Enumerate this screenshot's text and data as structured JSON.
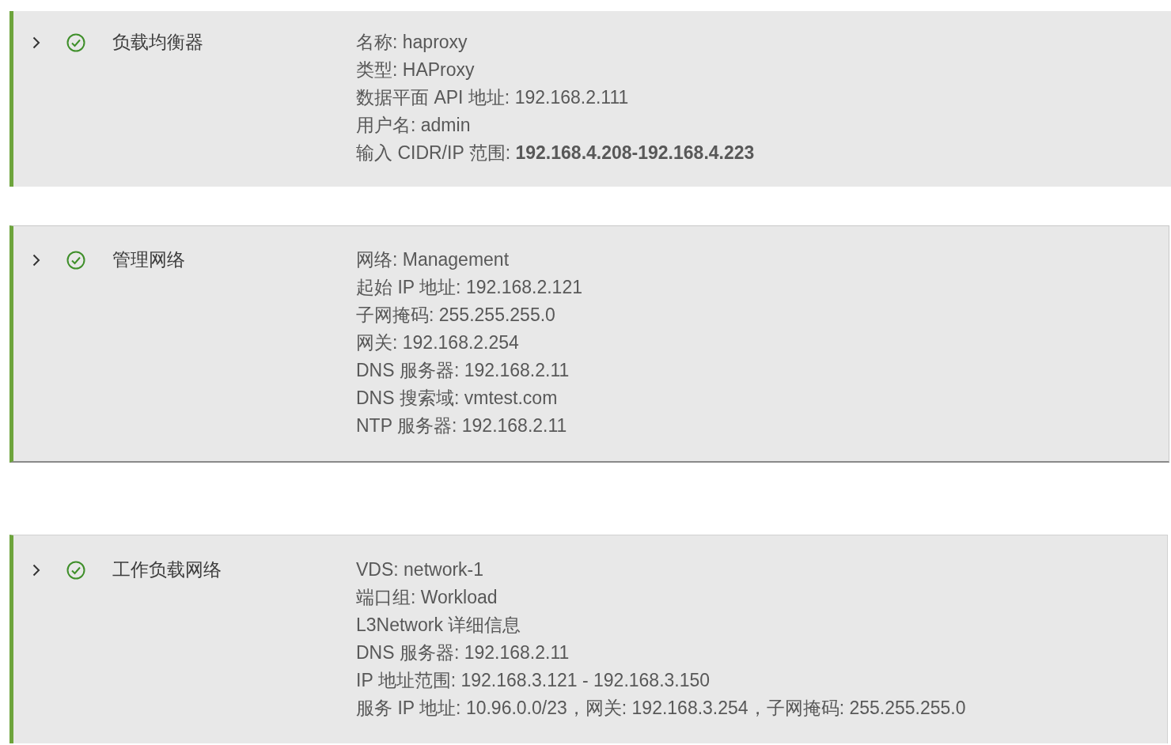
{
  "sections": [
    {
      "title": "负载均衡器",
      "expanded": false,
      "valid": true,
      "details": [
        "名称: haproxy",
        "类型: HAProxy",
        "数据平面 API 地址: 192.168.2.111",
        "用户名: admin",
        "输入 CIDR/IP 范围: **192.168.4.208-192.168.4.223**"
      ]
    },
    {
      "title": "管理网络",
      "expanded": false,
      "valid": true,
      "details": [
        "网络: Management",
        "起始 IP 地址: 192.168.2.121",
        "子网掩码: 255.255.255.0",
        "网关: 192.168.2.254",
        "DNS 服务器: 192.168.2.11",
        "DNS 搜索域: vmtest.com",
        "NTP 服务器: 192.168.2.11"
      ]
    },
    {
      "title": "工作负载网络",
      "expanded": false,
      "valid": true,
      "details": [
        "VDS: network-1",
        "端口组: Workload",
        "L3Network 详细信息",
        "DNS 服务器: 192.168.2.11",
        "IP 地址范围: 192.168.3.121 - 192.168.3.150",
        "服务 IP 地址: 10.96.0.0/23，网关: 192.168.3.254，子网掩码: 255.255.255.0"
      ]
    }
  ]
}
